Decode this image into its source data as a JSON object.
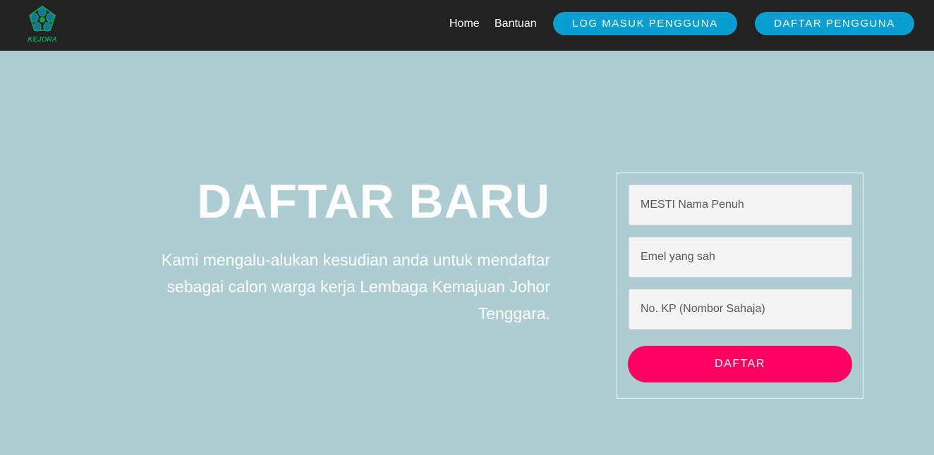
{
  "navbar": {
    "logo_text": "KEJORA",
    "links": {
      "home": "Home",
      "help": "Bantuan"
    },
    "buttons": {
      "login": "LOG MASUK PENGGUNA",
      "register": "DAFTAR PENGGUNA"
    },
    "background_color": "#222222",
    "button_color": "#0a9fd3"
  },
  "hero": {
    "title": "DAFTAR BARU",
    "description": "Kami mengalu-alukan kesudian anda untuk mendaftar sebagai calon warga kerja Lembaga Kemajuan Johor Tenggara."
  },
  "form": {
    "name_placeholder": "MESTI Nama Penuh",
    "email_placeholder": "Emel yang sah",
    "ic_placeholder": "No. KP (Nombor Sahaja)",
    "submit_label": "DAFTAR",
    "submit_color": "#ff0060"
  },
  "page": {
    "background_color": "#aecdd3"
  }
}
